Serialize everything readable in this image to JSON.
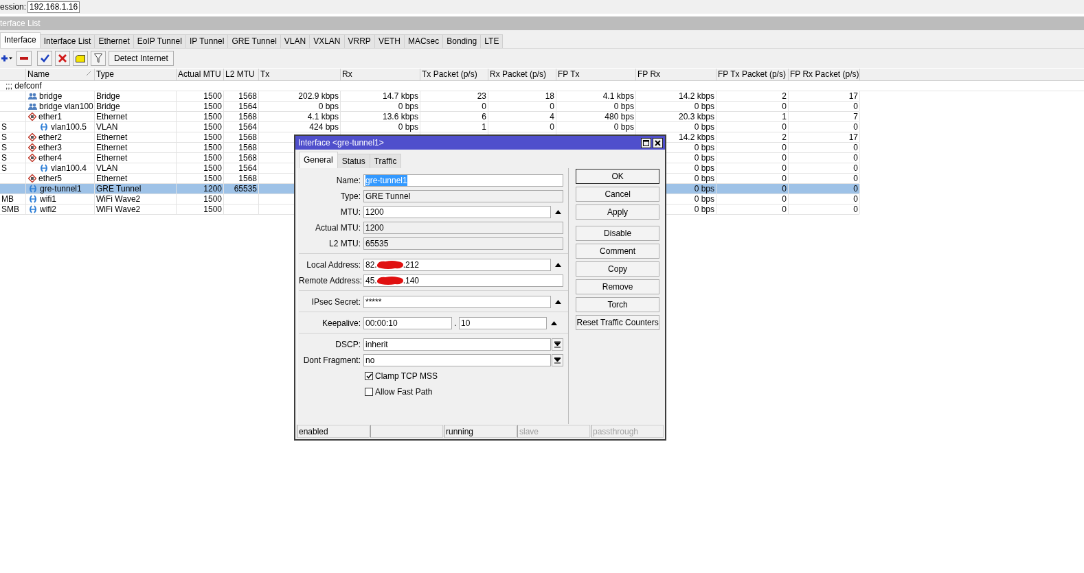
{
  "session": {
    "label": "ession:",
    "value": "192.168.1.16"
  },
  "window": {
    "title": "terface List"
  },
  "tabs": [
    {
      "label": "Interface",
      "selected": true
    },
    {
      "label": "Interface List",
      "selected": false
    },
    {
      "label": "Ethernet",
      "selected": false
    },
    {
      "label": "EoIP Tunnel",
      "selected": false
    },
    {
      "label": "IP Tunnel",
      "selected": false
    },
    {
      "label": "GRE Tunnel",
      "selected": false
    },
    {
      "label": "VLAN",
      "selected": false
    },
    {
      "label": "VXLAN",
      "selected": false
    },
    {
      "label": "VRRP",
      "selected": false
    },
    {
      "label": "VETH",
      "selected": false
    },
    {
      "label": "MACsec",
      "selected": false
    },
    {
      "label": "Bonding",
      "selected": false
    },
    {
      "label": "LTE",
      "selected": false
    }
  ],
  "toolbar": [
    {
      "kind": "add"
    },
    {
      "kind": "remove"
    },
    {
      "kind": "enable"
    },
    {
      "kind": "disable"
    },
    {
      "kind": "comment"
    },
    {
      "kind": "filter"
    },
    {
      "kind": "text",
      "label": "Detect Internet"
    }
  ],
  "table": {
    "columns": [
      {
        "label": "Name",
        "sorted": true
      },
      {
        "label": "Type"
      },
      {
        "label": "Actual MTU"
      },
      {
        "label": "L2 MTU"
      },
      {
        "label": "Tx"
      },
      {
        "label": "Rx"
      },
      {
        "label": "Tx Packet (p/s)"
      },
      {
        "label": "Rx Packet (p/s)"
      },
      {
        "label": "FP Tx"
      },
      {
        "label": "FP Rx"
      },
      {
        "label": "FP Tx Packet (p/s)"
      },
      {
        "label": "FP Rx Packet (p/s)"
      }
    ],
    "comment": ";;; defconf",
    "rows": [
      {
        "kind": "bridge",
        "name": "bridge",
        "selected": false,
        "values": [
          "Bridge",
          "1500",
          "1568",
          "202.9 kbps",
          "14.7 kbps",
          "23",
          "18",
          "4.1 kbps",
          "14.2 kbps",
          "2",
          "17"
        ]
      },
      {
        "kind": "bridge",
        "name": "bridge vlan100",
        "selected": false,
        "values": [
          "Bridge",
          "1500",
          "1564",
          "0 bps",
          "0 bps",
          "0",
          "0",
          "0 bps",
          "0 bps",
          "0",
          "0"
        ]
      },
      {
        "kind": "ethernet",
        "name": "ether1",
        "selected": false,
        "values": [
          "Ethernet",
          "1500",
          "1568",
          "4.1 kbps",
          "13.6 kbps",
          "6",
          "4",
          "480 bps",
          "20.3 kbps",
          "1",
          "7"
        ],
        "children": [
          {
            "kind": "tunnel",
            "flags": "S",
            "name": "vlan100.5",
            "selected": false,
            "values": [
              "VLAN",
              "1500",
              "1564",
              "424 bps",
              "0 bps",
              "1",
              "0",
              "0 bps",
              "0 bps",
              "0",
              "0"
            ]
          }
        ]
      },
      {
        "kind": "ethernet",
        "flags": "S",
        "name": "ether2",
        "selected": false,
        "values": [
          "Ethernet",
          "1500",
          "1568"
        ],
        "end_values": [
          "14.2 kbps",
          "2",
          "17"
        ]
      },
      {
        "kind": "ethernet",
        "flags": "S",
        "name": "ether3",
        "selected": false,
        "values": [
          "Ethernet",
          "1500",
          "1568"
        ],
        "end_values": [
          "0 bps",
          "0",
          "0"
        ]
      },
      {
        "kind": "ethernet",
        "flags": "S",
        "name": "ether4",
        "selected": false,
        "values": [
          "Ethernet",
          "1500",
          "1568"
        ],
        "end_values": [
          "0 bps",
          "0",
          "0"
        ],
        "children": [
          {
            "kind": "tunnel",
            "flags": "S",
            "name": "vlan100.4",
            "selected": false,
            "values": [
              "VLAN",
              "1500",
              "1564"
            ],
            "end_values": [
              "0 bps",
              "0",
              "0"
            ]
          }
        ]
      },
      {
        "kind": "ethernet",
        "name": "ether5",
        "selected": false,
        "values": [
          "Ethernet",
          "1500",
          "1568"
        ],
        "end_values": [
          "0 bps",
          "0",
          "0"
        ]
      },
      {
        "kind": "tunnel",
        "name": "gre-tunnel1",
        "selected": true,
        "values": [
          "GRE Tunnel",
          "1200",
          "65535"
        ],
        "end_values": [
          "0 bps",
          "0",
          "0"
        ]
      },
      {
        "kind": "tunnel",
        "flags": "MB",
        "name": "wifi1",
        "selected": false,
        "values": [
          "WiFi Wave2",
          "1500"
        ],
        "end_values": [
          "0 bps",
          "0",
          "0"
        ]
      },
      {
        "kind": "tunnel",
        "flags": "SMB",
        "name": "wifi2",
        "selected": false,
        "values": [
          "WiFi Wave2",
          "1500"
        ],
        "end_values": [
          "0 bps",
          "0",
          "0"
        ]
      }
    ]
  },
  "dialog": {
    "title": "Interface <gre-tunnel1>",
    "tabs": [
      {
        "label": "General",
        "selected": true
      },
      {
        "label": "Status",
        "selected": false
      },
      {
        "label": "Traffic",
        "selected": false
      }
    ],
    "groups": [
      [
        {
          "kind": "text",
          "label": "Name:",
          "value": "gre-tunnel1",
          "highlighted": true
        },
        {
          "kind": "readonly",
          "label": "Type:",
          "value": "GRE Tunnel"
        },
        {
          "kind": "text",
          "label": "MTU:",
          "value": "1200",
          "toggle": true
        },
        {
          "kind": "readonly",
          "label": "Actual MTU:",
          "value": "1200"
        },
        {
          "kind": "readonly",
          "label": "L2 MTU:",
          "value": "65535"
        }
      ],
      [
        {
          "kind": "redacted",
          "label": "Local Address:",
          "value_start": "82.",
          "value_end": ".212",
          "toggle": true
        },
        {
          "kind": "redacted",
          "label": "Remote Address:",
          "value_start": "45.",
          "value_end": ".140"
        }
      ],
      [
        {
          "kind": "text",
          "label": "IPsec Secret:",
          "value": "*****",
          "toggle": true
        }
      ],
      [
        {
          "kind": "pair",
          "label": "Keepalive:",
          "values": [
            "00:00:10",
            "10"
          ],
          "separator": ".",
          "toggle": true
        }
      ],
      [
        {
          "kind": "select",
          "label": "DSCP:",
          "value": "inherit"
        },
        {
          "kind": "select",
          "label": "Dont Fragment:",
          "value": "no"
        },
        {
          "kind": "checkbox",
          "label": "Clamp TCP MSS",
          "checked": true
        },
        {
          "kind": "checkbox",
          "label": "Allow Fast Path",
          "checked": false
        }
      ]
    ],
    "buttons": [
      {
        "label": "OK",
        "default": true
      },
      {
        "label": "Cancel",
        "default": false
      },
      {
        "label": "Apply",
        "default": false
      },
      {
        "label": "Disable",
        "default": false,
        "gap": true
      },
      {
        "label": "Comment",
        "default": false
      },
      {
        "label": "Copy",
        "default": false
      },
      {
        "label": "Remove",
        "default": false
      },
      {
        "label": "Torch",
        "default": false
      },
      {
        "label": "Reset Traffic Counters",
        "default": false
      }
    ],
    "status_bar": [
      {
        "kind": "text",
        "text": "enabled",
        "dimmed": false
      },
      {
        "kind": "blank"
      },
      {
        "kind": "text",
        "text": "running",
        "dimmed": false
      },
      {
        "kind": "text",
        "text": "slave",
        "dimmed": true
      },
      {
        "kind": "text",
        "text": "passthrough",
        "dimmed": true
      }
    ]
  }
}
